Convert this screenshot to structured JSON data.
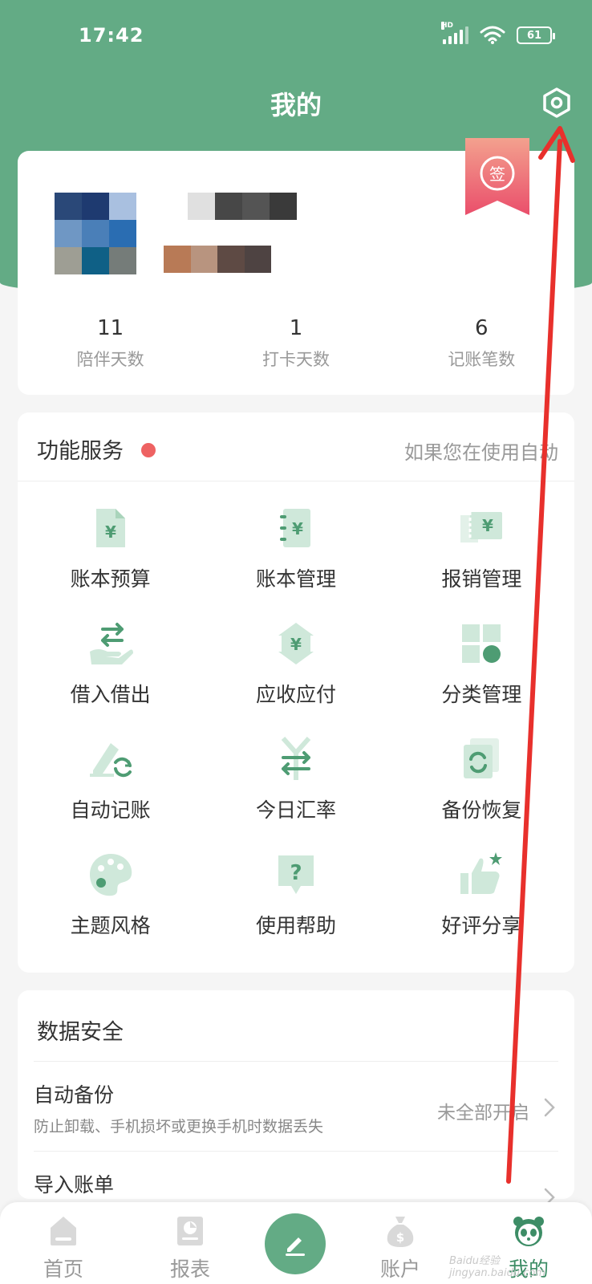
{
  "status_bar": {
    "time": "17:42",
    "network": "HD",
    "battery": "61"
  },
  "header": {
    "title": "我的"
  },
  "profile": {
    "sign_badge": "签",
    "stats": [
      {
        "value": "11",
        "label": "陪伴天数"
      },
      {
        "value": "1",
        "label": "打卡天数"
      },
      {
        "value": "6",
        "label": "记账笔数"
      }
    ]
  },
  "services": {
    "title": "功能服务",
    "notice": "如果您在使用自动",
    "items": [
      {
        "label": "账本预算",
        "icon": "budget-icon"
      },
      {
        "label": "账本管理",
        "icon": "ledger-icon"
      },
      {
        "label": "报销管理",
        "icon": "reimburse-icon"
      },
      {
        "label": "借入借出",
        "icon": "lend-icon"
      },
      {
        "label": "应收应付",
        "icon": "receivable-icon"
      },
      {
        "label": "分类管理",
        "icon": "category-icon"
      },
      {
        "label": "自动记账",
        "icon": "auto-record-icon"
      },
      {
        "label": "今日汇率",
        "icon": "exchange-rate-icon"
      },
      {
        "label": "备份恢复",
        "icon": "backup-icon"
      },
      {
        "label": "主题风格",
        "icon": "palette-icon"
      },
      {
        "label": "使用帮助",
        "icon": "help-icon"
      },
      {
        "label": "好评分享",
        "icon": "thumbs-up-icon"
      }
    ]
  },
  "security": {
    "title": "数据安全",
    "auto_backup": {
      "title": "自动备份",
      "subtitle": "防止卸载、手机损坏或更换手机时数据丢失",
      "value": "未全部开启"
    },
    "import": {
      "title": "导入账单"
    }
  },
  "tabbar": {
    "items": [
      {
        "label": "首页",
        "icon": "home-icon"
      },
      {
        "label": "报表",
        "icon": "report-icon"
      },
      {
        "label": "账户",
        "icon": "money-bag-icon"
      },
      {
        "label": "我的",
        "icon": "panda-icon"
      }
    ]
  },
  "watermark": "Baidu经验 jingyan.baidu.com",
  "colors": {
    "primary": "#63ab85",
    "icon_light": "#cfe8da",
    "icon_dark": "#4e9c73",
    "red": "#ee6262"
  }
}
